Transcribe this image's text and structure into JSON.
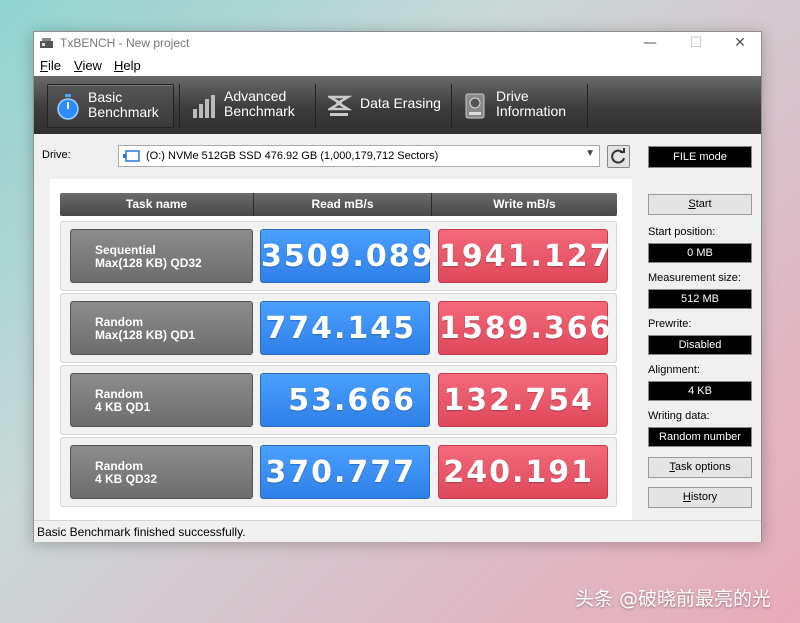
{
  "window": {
    "title": "TxBENCH - New project",
    "controls": {
      "minimize": "—",
      "maximize": "☐",
      "close": "✕"
    }
  },
  "menu": [
    "File",
    "View",
    "Help"
  ],
  "toolbar": {
    "tabs": [
      {
        "line1": "Basic",
        "line2": "Benchmark",
        "icon": "stopwatch-icon",
        "active": true
      },
      {
        "line1": "Advanced",
        "line2": "Benchmark",
        "icon": "bar-graph-icon",
        "active": false
      },
      {
        "line1": "Data Erasing",
        "line2": "",
        "icon": "eraser-icon",
        "active": false
      },
      {
        "line1": "Drive",
        "line2": "Information",
        "icon": "drive-info-icon",
        "active": false
      }
    ]
  },
  "drive": {
    "label": "Drive:",
    "selected": "(O:) NVMe 512GB SSD  476.92 GB (1,000,179,712 Sectors)"
  },
  "mode": "FILE mode",
  "table": {
    "headers": {
      "task": "Task name",
      "read": "Read mB/s",
      "write": "Write mB/s"
    },
    "rows": [
      {
        "line1": "Sequential",
        "line2": "Max(128 KB) QD32",
        "read": "3509.089",
        "write": "1941.127"
      },
      {
        "line1": "Random",
        "line2": "Max(128 KB) QD1",
        "read": "774.145",
        "write": "1589.366"
      },
      {
        "line1": "Random",
        "line2": "4 KB QD1",
        "read": "53.666",
        "write": "132.754"
      },
      {
        "line1": "Random",
        "line2": "4 KB QD32",
        "read": "370.777",
        "write": "240.191"
      }
    ]
  },
  "side": {
    "start_button": "Start",
    "start_position": {
      "label": "Start position:",
      "value": "0 MB"
    },
    "measurement_size": {
      "label": "Measurement size:",
      "value": "512 MB"
    },
    "prewrite": {
      "label": "Prewrite:",
      "value": "Disabled"
    },
    "alignment": {
      "label": "Alignment:",
      "value": "4 KB"
    },
    "writing_data": {
      "label": "Writing data:",
      "value": "Random number"
    },
    "task_options_button": "Task options",
    "history_button": "History"
  },
  "status": "Basic Benchmark finished successfully.",
  "watermark": "头条 @破晓前最亮的光",
  "colors": {
    "read": "#3a8cf5",
    "write": "#e8546a",
    "toolbar": "#3c3c3c"
  }
}
